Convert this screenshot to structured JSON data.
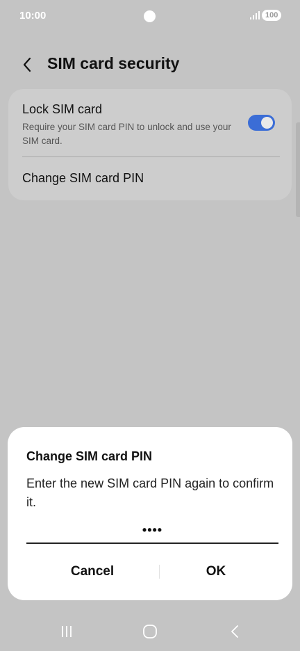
{
  "status_bar": {
    "time": "10:00",
    "battery": "100"
  },
  "header": {
    "title": "SIM card security",
    "back_icon": "chevron-left-icon"
  },
  "settings": {
    "lock_sim": {
      "title": "Lock SIM card",
      "description": "Require your SIM card PIN to unlock and use your SIM card.",
      "enabled": true
    },
    "change_pin_label": "Change SIM card PIN"
  },
  "dialog": {
    "title": "Change SIM card PIN",
    "message": "Enter the new SIM card PIN again to confirm it.",
    "pin_value": "••••",
    "cancel_label": "Cancel",
    "ok_label": "OK"
  },
  "nav": {
    "recents_icon": "recents-icon",
    "home_icon": "home-icon",
    "back_icon": "back-icon"
  },
  "colors": {
    "accent": "#3b6dd6",
    "background": "#c4c4c4",
    "card": "#cdcdcd",
    "dialog": "#ffffff"
  }
}
